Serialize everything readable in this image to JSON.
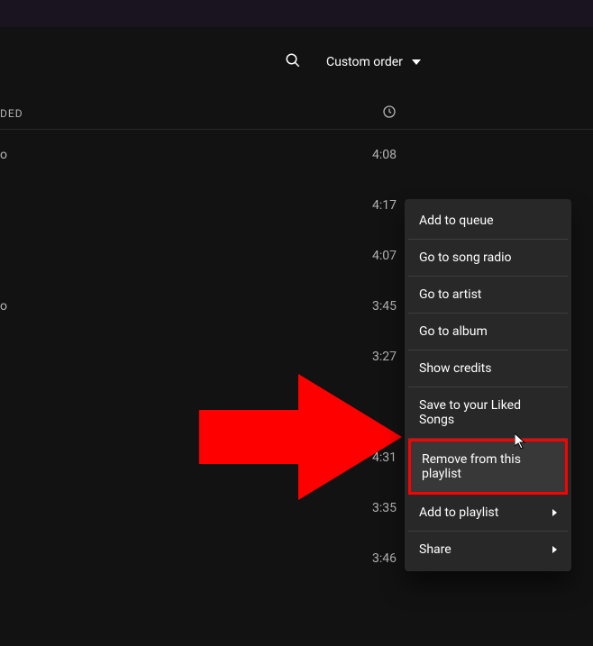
{
  "controls": {
    "sort_label": "Custom order"
  },
  "columns": {
    "added": "DED"
  },
  "tracks": [
    {
      "added": "o",
      "duration": "4:08"
    },
    {
      "added": "",
      "duration": "4:17"
    },
    {
      "added": "",
      "duration": "4:07"
    },
    {
      "added": "o",
      "duration": "3:45"
    },
    {
      "added": "",
      "duration": "3:27"
    },
    {
      "added": "",
      "duration": ""
    },
    {
      "added": "",
      "duration": "4:31"
    },
    {
      "added": "",
      "duration": "3:35"
    },
    {
      "added": "",
      "duration": "3:46"
    },
    {
      "added": "",
      "duration": ""
    }
  ],
  "context_menu": {
    "items": [
      {
        "label": "Add to queue",
        "submenu": false
      },
      {
        "label": "Go to song radio",
        "submenu": false
      },
      {
        "label": "Go to artist",
        "submenu": false
      },
      {
        "label": "Go to album",
        "submenu": false
      },
      {
        "label": "Show credits",
        "submenu": false
      },
      {
        "label": "Save to your Liked Songs",
        "submenu": false
      },
      {
        "label": "Remove from this playlist",
        "submenu": false,
        "highlighted": true
      },
      {
        "label": "Add to playlist",
        "submenu": true
      },
      {
        "label": "Share",
        "submenu": true
      }
    ]
  },
  "annotation": {
    "arrow_color": "#ff0000"
  }
}
